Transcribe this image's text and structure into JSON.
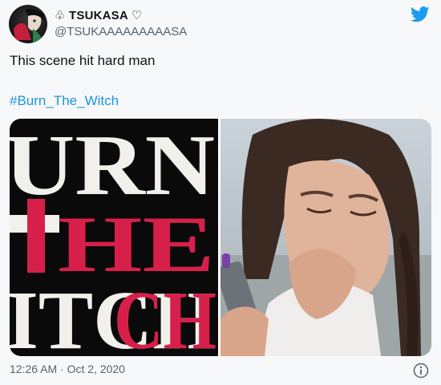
{
  "user": {
    "display_name": "♧ TSUKASA ♡",
    "handle": "@TSUKAAAAAAAAASA"
  },
  "tweet": {
    "text": "This scene hit hard man",
    "hashtag": "#Burn_The_Witch"
  },
  "media": {
    "left_image_lines": [
      "URN",
      "HE",
      "ITCH"
    ],
    "left_image_subject": "burn-the-witch-title-art",
    "right_image_subject": "crying-woman-with-phone"
  },
  "meta": {
    "timestamp": "12:26 AM · Oct 2, 2020"
  },
  "colors": {
    "accent": "#1d9bf0",
    "hashtag": "#1b95e0",
    "title_red": "#d6204a"
  },
  "icons": {
    "brand": "twitter-bird-icon",
    "info": "info-icon"
  }
}
